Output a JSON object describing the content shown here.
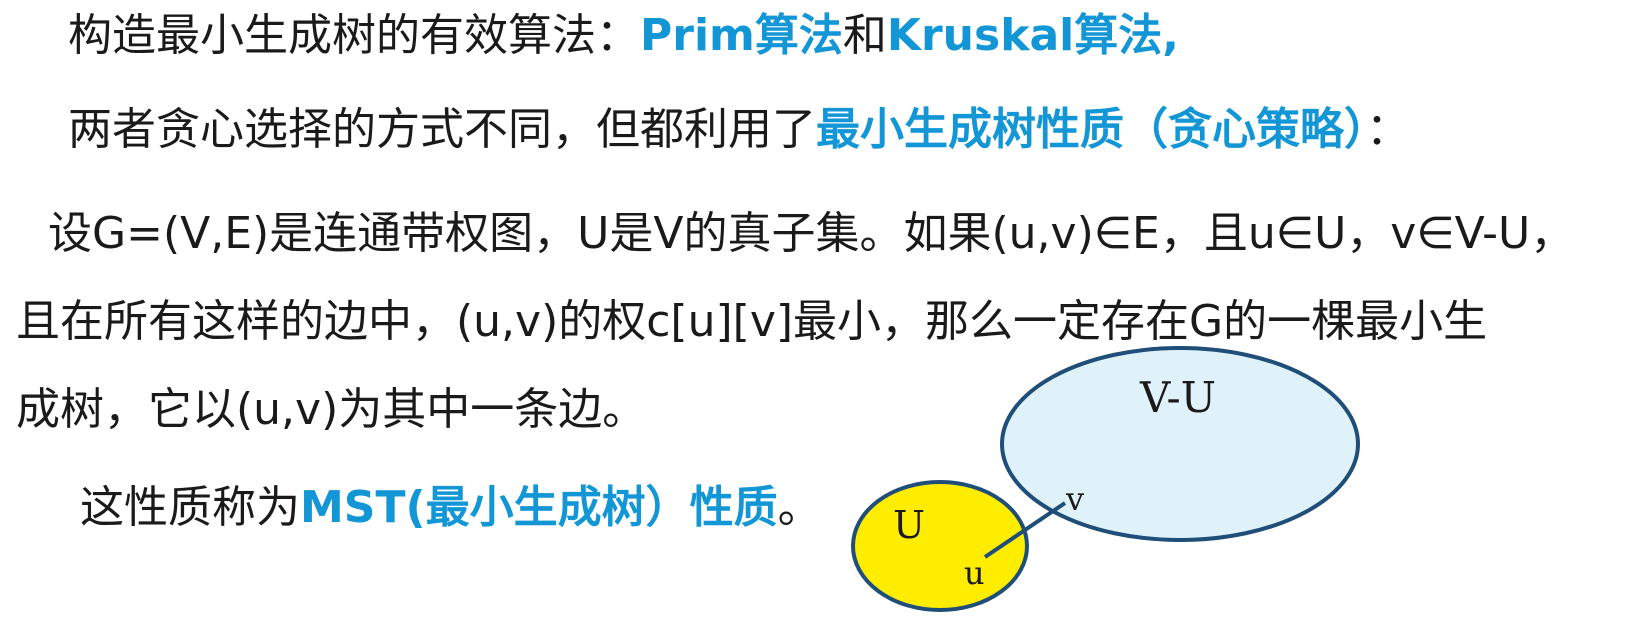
{
  "lines": {
    "l1": {
      "a": "构造最小生成树的有效算法：",
      "b": "Prim算法",
      "c": "和",
      "d": "Kruskal算法,"
    },
    "l2": {
      "a": "两者贪心选择的方式不同，但都利用了",
      "b": "最小生成树性质（贪心策略）",
      "c": "："
    },
    "l3": "设G=(V,E)是连通带权图，U是V的真子集。如果(u,v)∈E，且u∈U，v∈V-U，",
    "l4": "且在所有这样的边中，(u,v)的权c[u][v]最小，那么一定存在G的一棵最小生",
    "l5": "成树，它以(u,v)为其中一条边。",
    "l6": {
      "a": "这性质称为",
      "b": "MST(最小生成树）性质",
      "c": "。"
    }
  },
  "diagram": {
    "set_u_label": "U",
    "set_vu_label": "V-U",
    "node_u": "u",
    "node_v": "v",
    "colors": {
      "set_u_fill": "#ffed00",
      "set_vu_fill": "#dff2fa",
      "outline": "#1f4e79",
      "highlight_text": "#1296d6"
    }
  }
}
